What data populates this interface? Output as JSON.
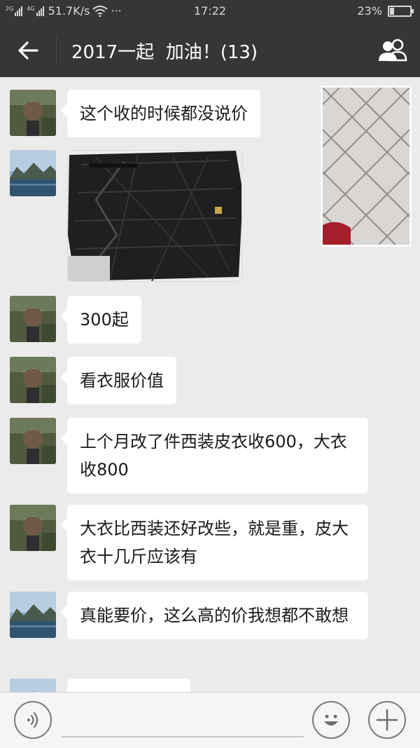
{
  "status_bar": {
    "network_label_1": "2G",
    "network_label_2": "4G",
    "speed": "51.7K/s",
    "wifi_icon": "wifi-icon",
    "more": "···",
    "time": "17:22",
    "battery_percent": "23%",
    "battery_level": 0.23
  },
  "header": {
    "back_icon": "arrow-left-icon",
    "title": "2017一起  加油！(13)",
    "members_icon": "group-people-icon"
  },
  "messages": [
    {
      "type": "text",
      "sender": "user-a",
      "text": "这个收的时候都没说价"
    },
    {
      "type": "image",
      "sender": "user-b",
      "content": "leather-jacket-photo"
    },
    {
      "type": "text",
      "sender": "user-a",
      "text": "300起"
    },
    {
      "type": "text",
      "sender": "user-a",
      "text": "看衣服价值"
    },
    {
      "type": "text",
      "sender": "user-a",
      "text": "上个月改了件西装皮衣收600，大衣收800"
    },
    {
      "type": "text",
      "sender": "user-a",
      "text": "大衣比西装还好改些，就是重，皮大衣十几斤应该有"
    },
    {
      "type": "text",
      "sender": "user-b",
      "text": "真能要价，这么高的价我想都不敢想"
    }
  ],
  "input_bar": {
    "voice_icon": "voice-icon",
    "emoji_icon": "smiley-icon",
    "plus_icon": "plus-icon",
    "placeholder": ""
  },
  "colors": {
    "header_bg": "#363636",
    "chat_bg": "#ebebeb",
    "bubble_bg": "#ffffff"
  }
}
